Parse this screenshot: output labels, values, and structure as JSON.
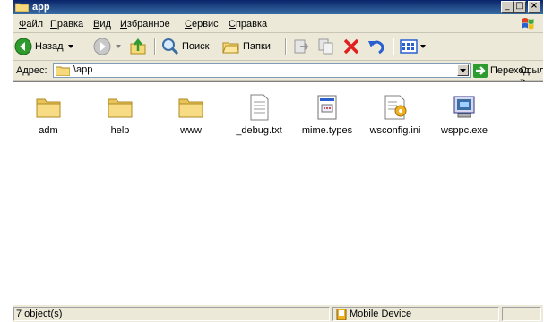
{
  "window": {
    "title": "app",
    "minimize": "_",
    "maximize": "□",
    "close": "×"
  },
  "menu": {
    "items": [
      {
        "label": "Файл",
        "ul": "Ф",
        "rest": "айл"
      },
      {
        "label": "Правка",
        "ul": "П",
        "rest": "равка"
      },
      {
        "label": "Вид",
        "ul": "В",
        "rest": "ид"
      },
      {
        "label": "Избранное",
        "ul": "И",
        "rest": "збранное"
      },
      {
        "label": "Сервис",
        "ul": "С",
        "rest": "ервис"
      },
      {
        "label": "Справка",
        "ul": "С",
        "rest": "правка"
      }
    ]
  },
  "toolbar": {
    "back": "Назад",
    "search": "Поиск",
    "folders": "Папки"
  },
  "address": {
    "label": "Адрес:",
    "value": "\\app",
    "go": "Переход",
    "links": "Ссылки"
  },
  "files": [
    {
      "name": "adm",
      "icon": "folder-icon"
    },
    {
      "name": "help",
      "icon": "folder-icon"
    },
    {
      "name": "www",
      "icon": "folder-icon"
    },
    {
      "name": "_debug.txt",
      "icon": "text-file-icon"
    },
    {
      "name": "mime.types",
      "icon": "types-file-icon"
    },
    {
      "name": "wsconfig.ini",
      "icon": "ini-file-icon"
    },
    {
      "name": "wsppc.exe",
      "icon": "exe-file-icon"
    }
  ],
  "status": {
    "count": "7 object(s)",
    "location": "Mobile Device"
  },
  "colors": {
    "title_bar": "#0a246a",
    "window_bg": "#ece9d8",
    "folder": "#f5d97a",
    "go_arrow": "#2e9b2e"
  }
}
